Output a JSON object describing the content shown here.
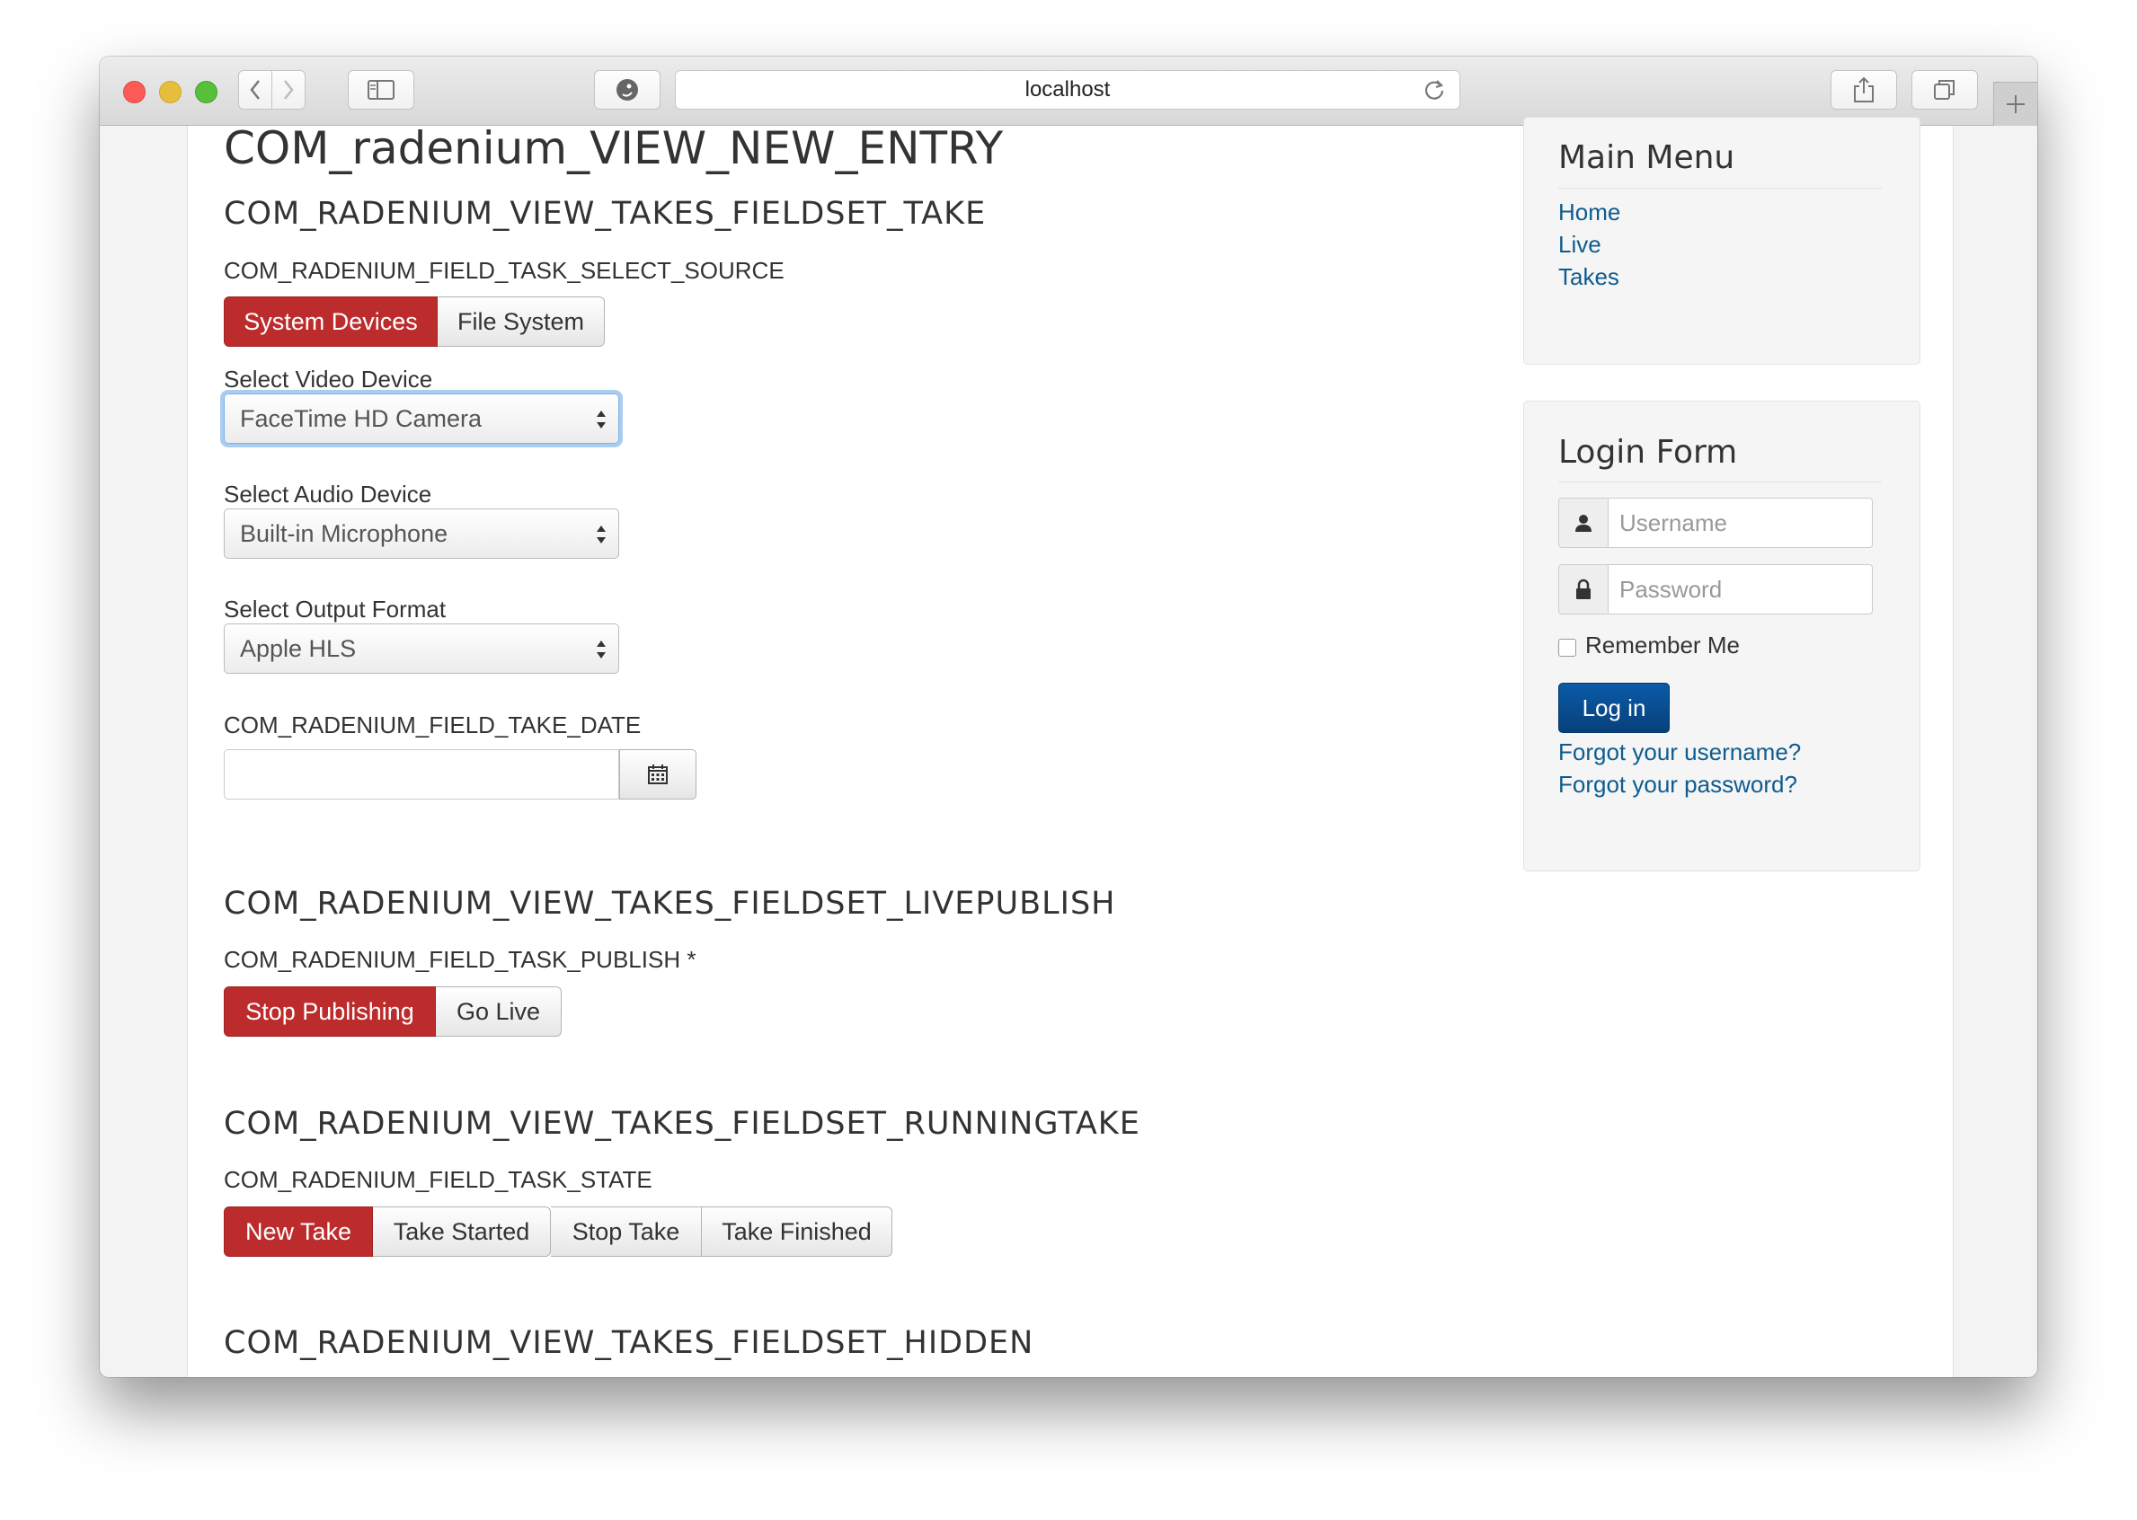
{
  "browser": {
    "address": "localhost",
    "traffic_lights": {
      "close": "#fc5b57",
      "minimize": "#e5bf3c",
      "zoom": "#57c038"
    }
  },
  "main": {
    "title": "COM_radenium_VIEW_NEW_ENTRY",
    "fieldset_take": {
      "heading": "COM_RADENIUM_VIEW_TAKES_FIELDSET_TAKE",
      "source_label": "COM_RADENIUM_FIELD_TASK_SELECT_SOURCE",
      "source_options": [
        "System Devices",
        "File System"
      ],
      "video_label": "Select Video Device",
      "video_value": "FaceTime HD Camera",
      "audio_label": "Select Audio Device",
      "audio_value": "Built-in Microphone",
      "format_label": "Select Output Format",
      "format_value": "Apple HLS",
      "date_label": "COM_RADENIUM_FIELD_TAKE_DATE",
      "date_value": ""
    },
    "fieldset_livepublish": {
      "heading": "COM_RADENIUM_VIEW_TAKES_FIELDSET_LIVEPUBLISH",
      "publish_label": "COM_RADENIUM_FIELD_TASK_PUBLISH *",
      "publish_options": [
        "Stop Publishing",
        "Go Live"
      ]
    },
    "fieldset_runningtake": {
      "heading": "COM_RADENIUM_VIEW_TAKES_FIELDSET_RUNNINGTAKE",
      "state_label": "COM_RADENIUM_FIELD_TASK_STATE",
      "state_options": [
        "New Take",
        "Take Started",
        "Stop Take",
        "Take Finished"
      ]
    },
    "fieldset_hidden": {
      "heading": "COM_RADENIUM_VIEW_TAKES_FIELDSET_HIDDEN"
    }
  },
  "sidebar": {
    "main_menu": {
      "title": "Main Menu",
      "items": [
        "Home",
        "Live",
        "Takes"
      ]
    },
    "login_form": {
      "title": "Login Form",
      "username_placeholder": "Username",
      "password_placeholder": "Password",
      "remember_label": "Remember Me",
      "login_button": "Log in",
      "forgot_username": "Forgot your username?",
      "forgot_password": "Forgot your password?"
    }
  },
  "colors": {
    "active_button": "#bd2c2c",
    "primary_button": "#0a5ba8",
    "link": "#0e5c8f"
  }
}
